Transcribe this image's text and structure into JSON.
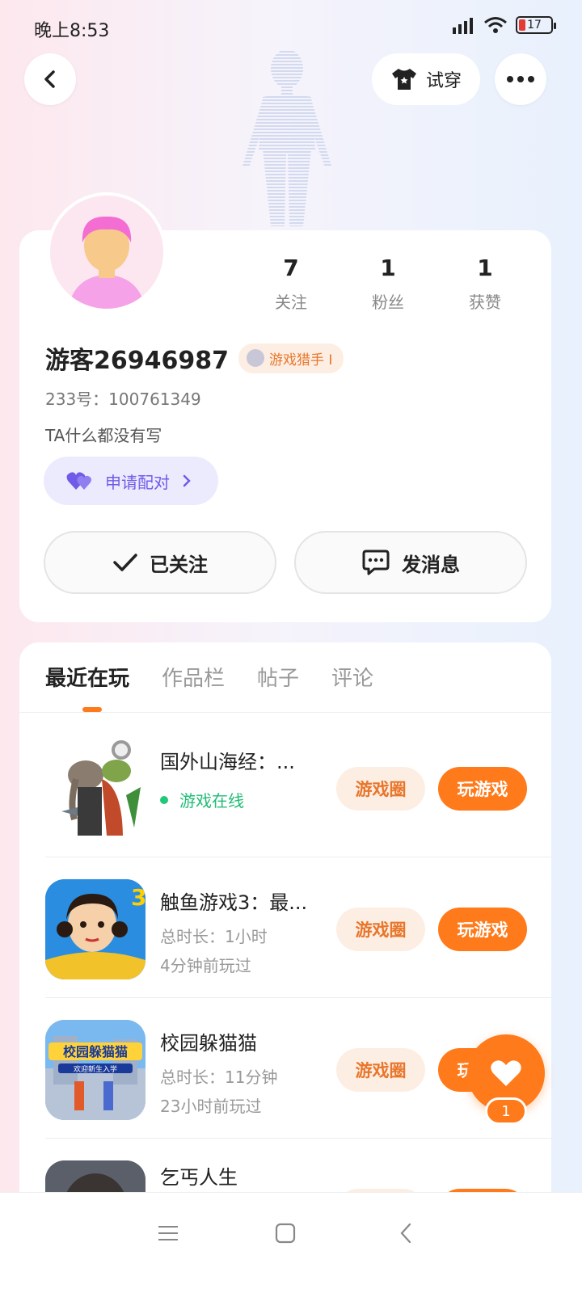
{
  "status_bar": {
    "time": "晚上8:53",
    "battery": "17"
  },
  "header": {
    "tryon_label": "试穿"
  },
  "profile": {
    "stats": [
      {
        "value": "7",
        "label": "关注"
      },
      {
        "value": "1",
        "label": "粉丝"
      },
      {
        "value": "1",
        "label": "获赞"
      }
    ],
    "username": "游客26946987",
    "badge": "游戏猎手 I",
    "uid": "233号：100761349",
    "bio": "TA什么都没有写",
    "pair_label": "申请配对",
    "follow_label": "已关注",
    "message_label": "发消息"
  },
  "tabs": [
    "最近在玩",
    "作品栏",
    "帖子",
    "评论"
  ],
  "games": [
    {
      "title": "国外山海经：...",
      "line1": "游戏在线",
      "line2": ""
    },
    {
      "title": "触鱼游戏3：最...",
      "line1": "总时长：1小时",
      "line2": "4分钟前玩过"
    },
    {
      "title": "校园躲猫猫",
      "line1": "总时长：11分钟",
      "line2": "23小时前玩过"
    },
    {
      "title": "乞丐人生",
      "line1": "",
      "line2": ""
    }
  ],
  "game_buttons": {
    "circle": "游戏圈",
    "play": "玩游戏"
  },
  "thumb_texts": {
    "squid_number": "3",
    "campus_title": "校园躲猫猫",
    "campus_sub": "欢迎新生入学"
  },
  "fab": {
    "count": "1"
  }
}
